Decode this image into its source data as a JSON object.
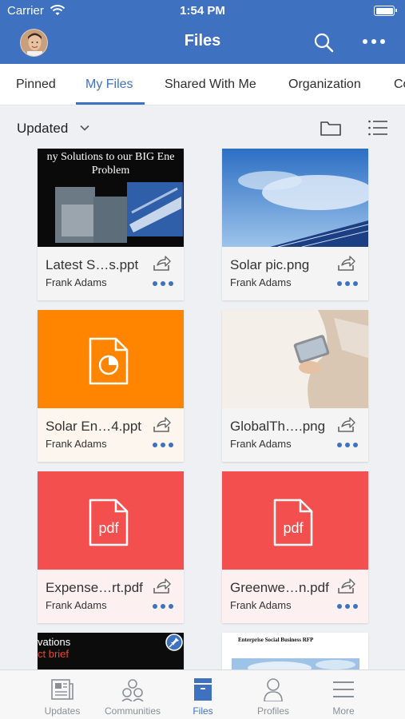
{
  "status_bar": {
    "carrier": "Carrier",
    "time": "1:54 PM"
  },
  "header": {
    "title": "Files",
    "search_icon": "search-icon",
    "more_icon": "more-horizontal-icon"
  },
  "tabs": [
    {
      "label": "Pinned",
      "active": false
    },
    {
      "label": "My Files",
      "active": true
    },
    {
      "label": "Shared With Me",
      "active": false
    },
    {
      "label": "Organization",
      "active": false
    },
    {
      "label": "Co",
      "active": false
    }
  ],
  "sort": {
    "label": "Updated"
  },
  "colors": {
    "brand": "#3e72c1",
    "orange": "#ff8500",
    "red": "#f34f4f"
  },
  "files": [
    {
      "name": "Latest S…s.ppt",
      "owner": "Frank Adams",
      "thumb_text": "ny Solutions to our BIG Ene Problem"
    },
    {
      "name": "Solar pic.png",
      "owner": "Frank Adams"
    },
    {
      "name": "Solar En…4.ppt",
      "owner": "Frank Adams"
    },
    {
      "name": "GlobalTh….png",
      "owner": "Frank Adams"
    },
    {
      "name": "Expense…rt.pdf",
      "owner": "Frank Adams",
      "badge": "pdf"
    },
    {
      "name": "Greenwe…n.pdf",
      "owner": "Frank Adams",
      "badge": "pdf"
    },
    {
      "thumb_line1": "vations",
      "thumb_line2": "ct brief"
    },
    {
      "thumb_title": "Enterprise Social Business RFP"
    }
  ],
  "nav": [
    {
      "label": "Updates",
      "icon": "newspaper-icon"
    },
    {
      "label": "Communities",
      "icon": "people-icon"
    },
    {
      "label": "Files",
      "icon": "files-icon",
      "active": true
    },
    {
      "label": "Profiles",
      "icon": "profile-icon"
    },
    {
      "label": "More",
      "icon": "menu-icon"
    }
  ]
}
